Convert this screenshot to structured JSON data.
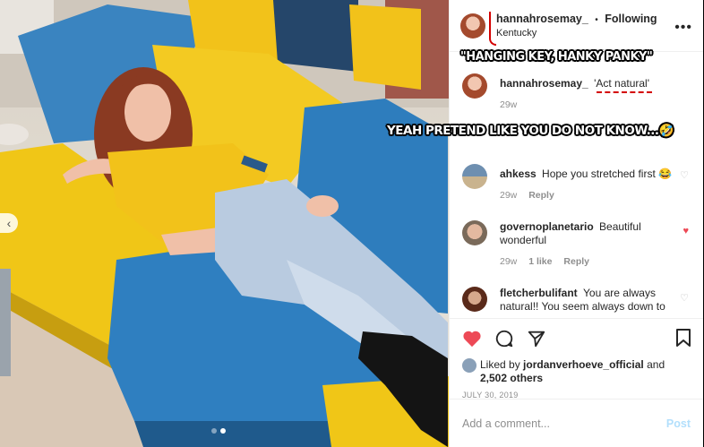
{
  "post": {
    "username": "hannahrosemay_",
    "separator": "•",
    "follow_status": "Following",
    "location": "Kentucky",
    "more_label": "•••"
  },
  "caption": {
    "username": "hannahrosemay_",
    "text": "'Act natural'",
    "age": "29w"
  },
  "meme_overlays": {
    "top": "\"HANGING KEY, HANKY PANKY\"",
    "middle": "YEAH PRETEND LIKE YOU DO NOT KNOW...🤣"
  },
  "comments": [
    {
      "username": "ahkess",
      "text": "Hope you stretched first 😂",
      "age": "29w",
      "likes": "",
      "reply": "Reply",
      "liked": false
    },
    {
      "username": "governoplanetario",
      "text": "Beautiful wonderful",
      "age": "29w",
      "likes": "1 like",
      "reply": "Reply",
      "liked": true
    },
    {
      "username": "fletcherbulifant",
      "text": "You are always natural!! You seem always down to",
      "age": "",
      "likes": "",
      "reply": "",
      "liked": false
    }
  ],
  "likes": {
    "prefix": "Liked by",
    "user": "jordanverhoeve_official",
    "conjunction": "and",
    "count": "2,502 others"
  },
  "date": "JULY 30, 2019",
  "add_comment": {
    "placeholder": "Add a comment...",
    "post_label": "Post"
  },
  "carousel": {
    "total": 2,
    "active_index": 1
  },
  "colors": {
    "like_red": "#ed4956",
    "annotation_red": "#d40000",
    "post_blue": "#b2dffc"
  }
}
